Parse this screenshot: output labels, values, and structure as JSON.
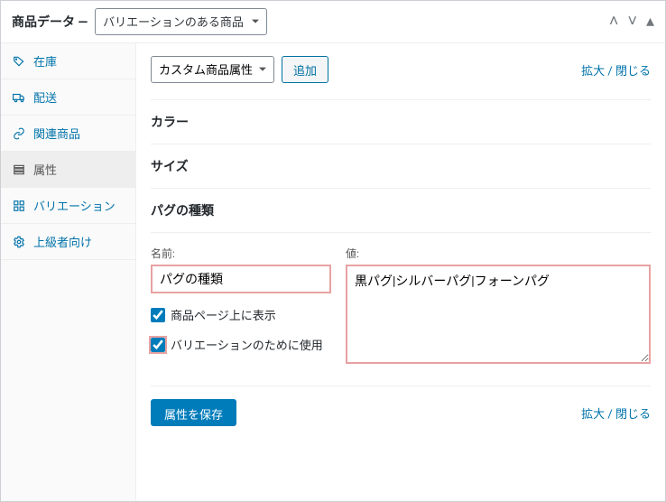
{
  "header": {
    "title": "商品データ —",
    "product_type": "バリエーションのある商品"
  },
  "sidebar": {
    "items": [
      {
        "label": "在庫"
      },
      {
        "label": "配送"
      },
      {
        "label": "関連商品"
      },
      {
        "label": "属性"
      },
      {
        "label": "バリエーション"
      },
      {
        "label": "上級者向け"
      }
    ]
  },
  "content": {
    "attr_type": "カスタム商品属性",
    "add_button": "追加",
    "expand_toggle": "拡大 / 閉じる",
    "attributes": [
      {
        "title": "カラー"
      },
      {
        "title": "サイズ"
      },
      {
        "title": "パグの種類"
      }
    ],
    "form": {
      "name_label": "名前:",
      "name_value": "パグの種類",
      "value_label": "値:",
      "value_text": "黒パグ|シルバーパグ|フォーンパグ",
      "visible_label": "商品ページ上に表示",
      "variation_label": "バリエーションのために使用"
    },
    "save_button": "属性を保存"
  }
}
